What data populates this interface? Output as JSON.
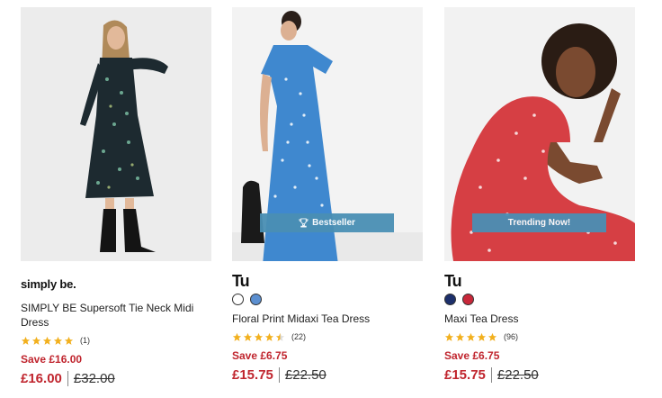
{
  "colors": {
    "sale": "#c0252e",
    "star": "#f2b01e",
    "badge": "#4a8fb4"
  },
  "products": [
    {
      "brand": "simply be.",
      "name": "SIMPLY BE Supersoft Tie Neck Midi Dress",
      "rating": 5,
      "review_count": "(1)",
      "save": "Save £16.00",
      "price": "£16.00",
      "was": "£32.00",
      "swatches": []
    },
    {
      "brand": "Tu",
      "name": "Floral Print Midaxi Tea Dress",
      "rating": 4.5,
      "review_count": "(22)",
      "save": "Save £6.75",
      "price": "£15.75",
      "was": "£22.50",
      "badge": "Bestseller",
      "badge_icon": "trophy-icon",
      "swatches": [
        "#ffffff",
        "#5b8fd0"
      ]
    },
    {
      "brand": "Tu",
      "name": "Maxi Tea Dress",
      "rating": 5,
      "review_count": "(96)",
      "save": "Save £6.75",
      "price": "£15.75",
      "was": "£22.50",
      "badge": "Trending Now!",
      "swatches": [
        "#1c2f6b",
        "#c8283a"
      ]
    }
  ]
}
